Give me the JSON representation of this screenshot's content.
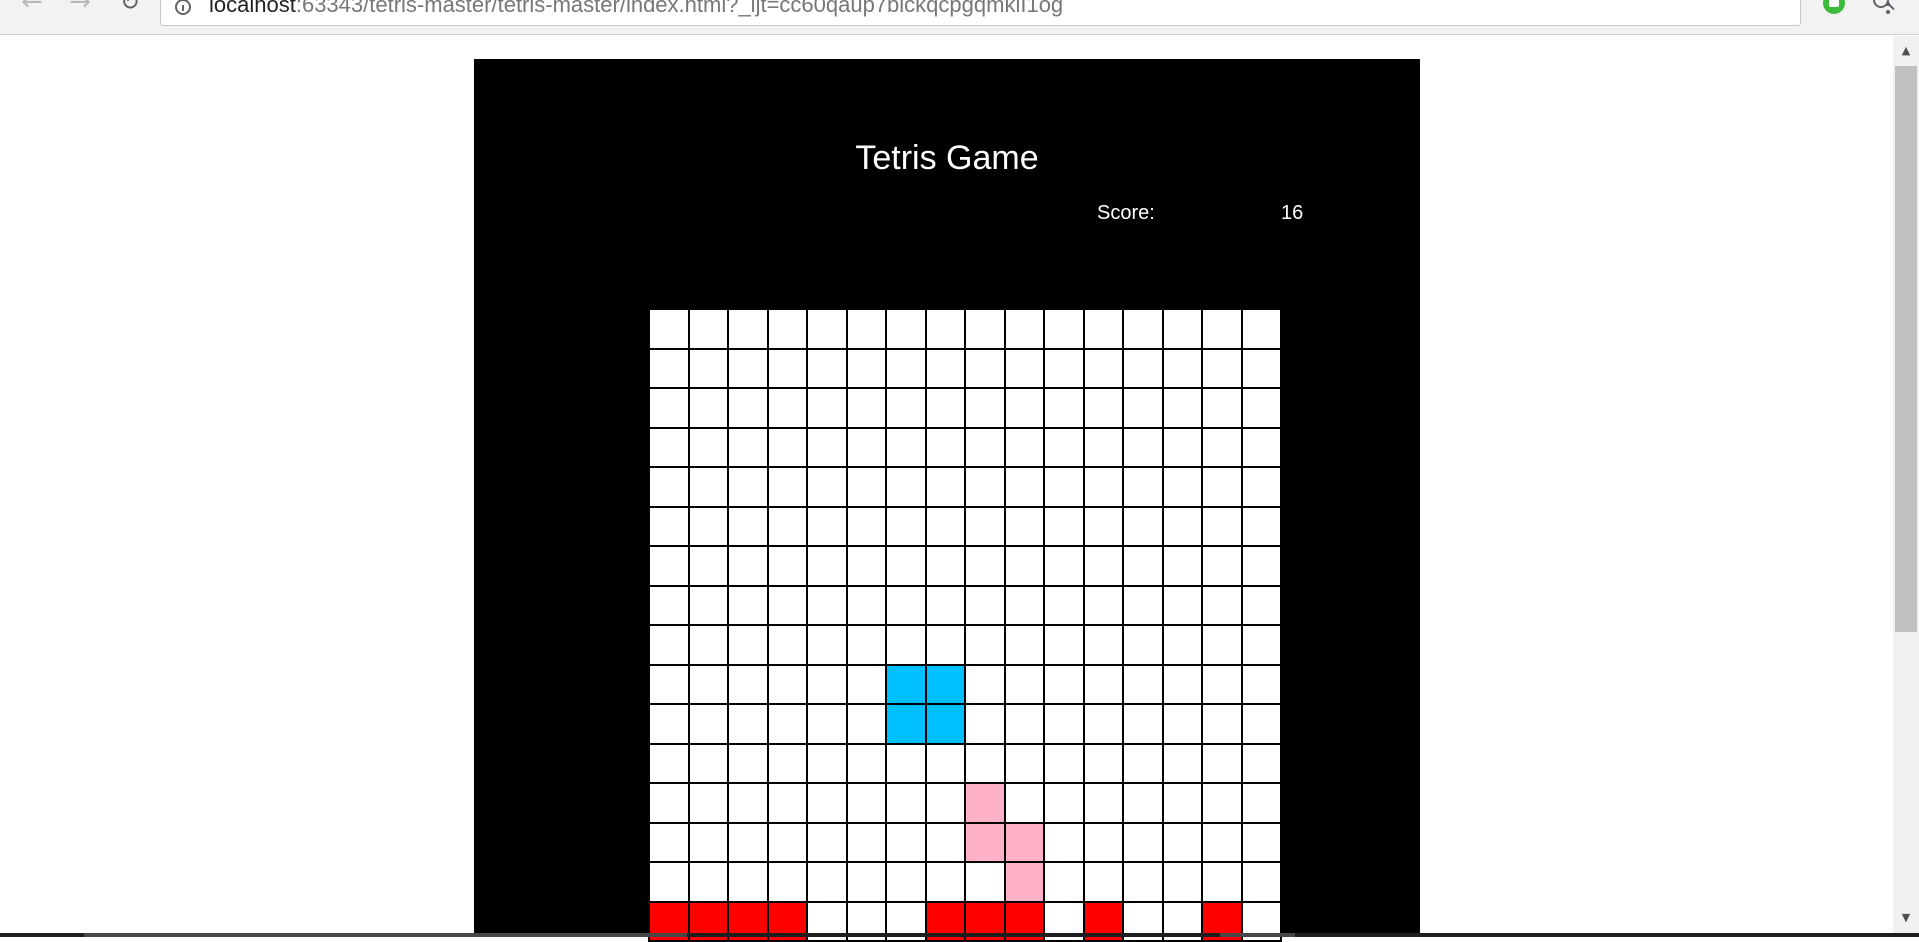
{
  "browser": {
    "url_host": "localhost",
    "url_path": ":63343/tetris-master/tetris-master/index.html?_ijt=cc60qaup7bickqcpgqmkiI1og",
    "back_icon": "back-arrow-icon",
    "forward_icon": "forward-arrow-icon",
    "reload_icon": "reload-icon",
    "info_icon": "info-icon",
    "zoom_icon": "zoom-icon",
    "star_icon": "bookmark-star-icon",
    "extension_icon": "extension-icon",
    "menu_icon": "kebab-menu-icon"
  },
  "game": {
    "title": "Tetris Game",
    "score_label": "Score:",
    "score_value": "16",
    "board": {
      "columns": 16,
      "visible_rows": 16,
      "colors": {
        "empty": "#ffffff",
        "grid": "#000000",
        "O": "#00bfff",
        "S": "#ffb1c8",
        "locked": "#ff0000"
      },
      "filled_cells": [
        {
          "row": 9,
          "col": 6,
          "piece": "O"
        },
        {
          "row": 9,
          "col": 7,
          "piece": "O"
        },
        {
          "row": 10,
          "col": 6,
          "piece": "O"
        },
        {
          "row": 10,
          "col": 7,
          "piece": "O"
        },
        {
          "row": 12,
          "col": 8,
          "piece": "S"
        },
        {
          "row": 13,
          "col": 8,
          "piece": "S"
        },
        {
          "row": 13,
          "col": 9,
          "piece": "S"
        },
        {
          "row": 14,
          "col": 9,
          "piece": "S"
        },
        {
          "row": 15,
          "col": 0,
          "piece": "locked"
        },
        {
          "row": 15,
          "col": 1,
          "piece": "locked"
        },
        {
          "row": 15,
          "col": 2,
          "piece": "locked"
        },
        {
          "row": 15,
          "col": 3,
          "piece": "locked"
        },
        {
          "row": 15,
          "col": 7,
          "piece": "locked"
        },
        {
          "row": 15,
          "col": 8,
          "piece": "locked"
        },
        {
          "row": 15,
          "col": 9,
          "piece": "locked"
        },
        {
          "row": 15,
          "col": 11,
          "piece": "locked"
        },
        {
          "row": 15,
          "col": 14,
          "piece": "locked"
        }
      ]
    }
  }
}
